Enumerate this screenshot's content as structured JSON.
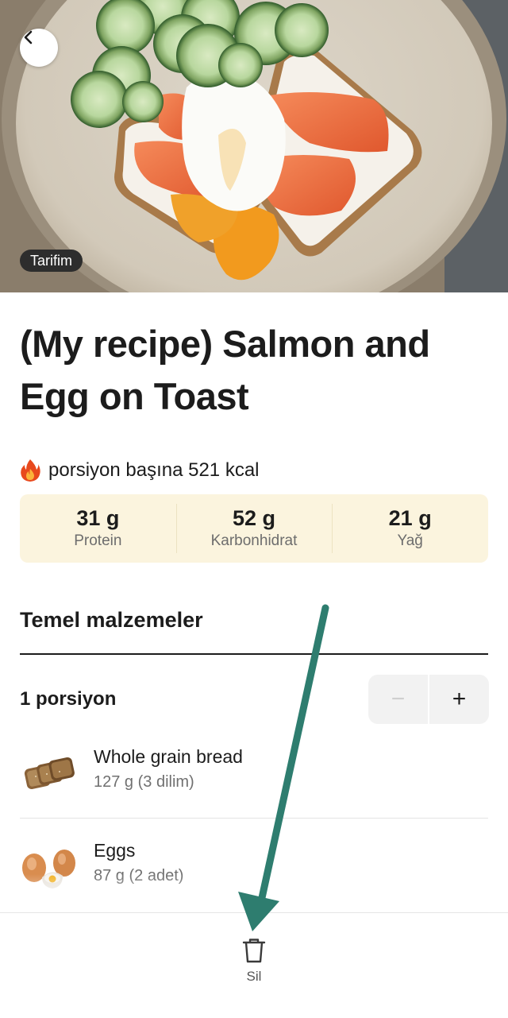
{
  "hero": {
    "badge": "Tarifim",
    "back_icon": "chevron-left-icon"
  },
  "recipe": {
    "title": "(My recipe) Salmon and Egg on Toast",
    "kcal_text": "porsiyon başına 521 kcal",
    "kcal_icon": "flame-icon"
  },
  "macros": [
    {
      "value": "31 g",
      "label": "Protein"
    },
    {
      "value": "52 g",
      "label": "Karbonhidrat"
    },
    {
      "value": "21 g",
      "label": "Yağ"
    }
  ],
  "ingredients_section": {
    "title": "Temel malzemeler",
    "portion_label": "1 porsiyon",
    "stepper": {
      "minus": "−",
      "plus": "+",
      "minus_enabled": false
    }
  },
  "ingredients": [
    {
      "name": "Whole grain bread",
      "amount": "127 g (3 dilim)",
      "icon": "bread-icon"
    },
    {
      "name": "Eggs",
      "amount": "87 g (2 adet)",
      "icon": "egg-icon"
    }
  ],
  "bottom_bar": {
    "delete_label": "Sil",
    "delete_icon": "trash-icon"
  },
  "colors": {
    "macro_background": "#fbf4de",
    "annotation_arrow": "#2e7d6f",
    "badge_background": "#2d2d2d"
  }
}
